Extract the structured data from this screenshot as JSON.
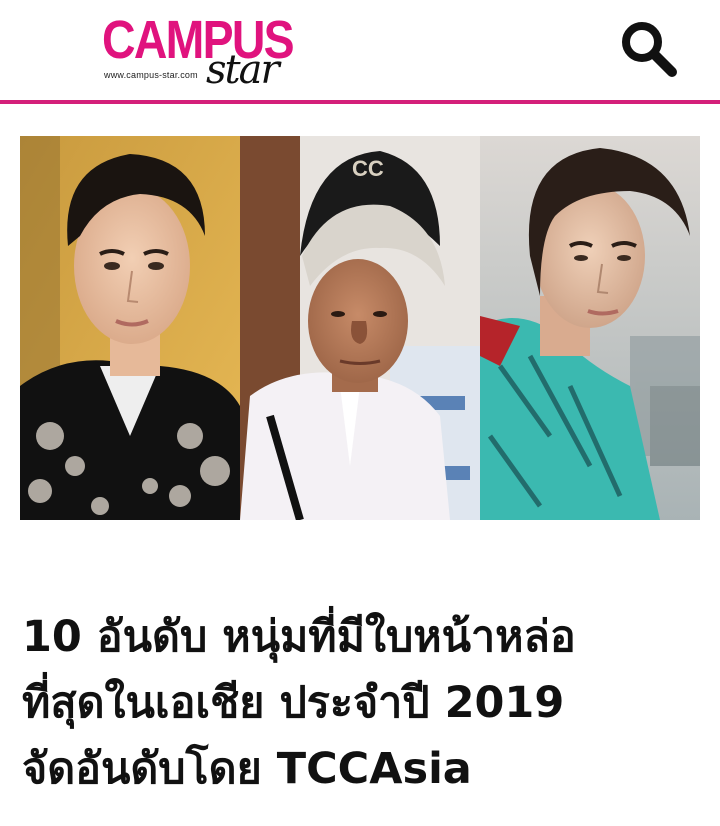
{
  "header": {
    "logo_main": "CAMPUS",
    "logo_script": "star",
    "logo_url": "www.campus-star.com",
    "search_icon": "search-icon",
    "accent_color": "#d4207a"
  },
  "article": {
    "title_lines": [
      "10 อันดับ หนุ่มที่มีใบหน้าหล่อ",
      "ที่สุดในเอเชีย ประจำปี 2019",
      "จัดอันดับโดย TCCAsia"
    ]
  },
  "photos": [
    {
      "description_icon": "portrait-photo"
    },
    {
      "description_icon": "portrait-photo"
    },
    {
      "description_icon": "portrait-photo"
    }
  ]
}
